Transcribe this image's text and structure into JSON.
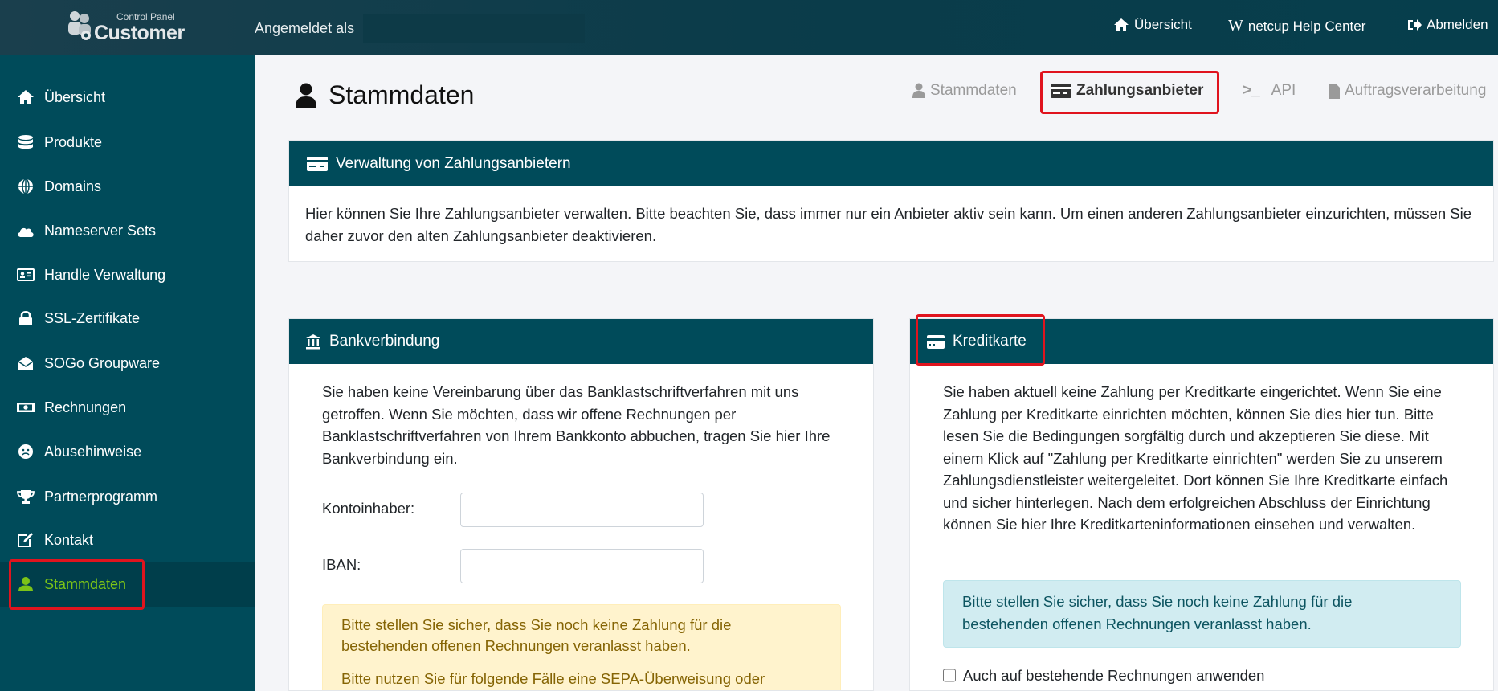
{
  "header": {
    "logo": {
      "top": "Control Panel",
      "main": "Customer"
    },
    "logged_in_label": "Angemeldet als",
    "links": [
      {
        "label": "Übersicht",
        "icon": "home-icon"
      },
      {
        "label": "netcup Help Center",
        "icon": "wiki-icon",
        "glyph": "W"
      },
      {
        "label": "Abmelden",
        "icon": "logout-icon"
      }
    ]
  },
  "sidebar": {
    "items": [
      {
        "label": "Übersicht",
        "icon": "home-icon"
      },
      {
        "label": "Produkte",
        "icon": "database-icon"
      },
      {
        "label": "Domains",
        "icon": "globe-icon"
      },
      {
        "label": "Nameserver Sets",
        "icon": "cloud-icon"
      },
      {
        "label": "Handle Verwaltung",
        "icon": "id-card-icon"
      },
      {
        "label": "SSL-Zertifikate",
        "icon": "lock-icon"
      },
      {
        "label": "SOGo Groupware",
        "icon": "envelope-open-icon"
      },
      {
        "label": "Rechnungen",
        "icon": "money-icon"
      },
      {
        "label": "Abusehinweise",
        "icon": "frown-icon"
      },
      {
        "label": "Partnerprogramm",
        "icon": "trophy-icon"
      },
      {
        "label": "Kontakt",
        "icon": "edit-icon"
      },
      {
        "label": "Stammdaten",
        "icon": "user-icon",
        "active": true
      }
    ],
    "active_color": "#7cc318"
  },
  "page": {
    "title": "Stammdaten",
    "tabs": [
      {
        "label": "Stammdaten",
        "icon": "user-icon"
      },
      {
        "label": "Zahlungsanbieter",
        "icon": "credit-card-icon",
        "active": true
      },
      {
        "label": "API",
        "icon": "terminal-icon"
      },
      {
        "label": "Auftragsverarbeitung",
        "icon": "file-icon"
      }
    ]
  },
  "overview_panel": {
    "title": "Verwaltung von Zahlungsanbietern",
    "text": "Hier können Sie Ihre Zahlungsanbieter verwalten. Bitte beachten Sie, dass immer nur ein Anbieter aktiv sein kann. Um einen anderen Zahlungsanbieter einzurichten, müssen Sie daher zuvor den alten Zahlungsanbieter deaktivieren."
  },
  "bank_panel": {
    "title": "Bankverbindung",
    "text": "Sie haben keine Vereinbarung über das Banklastschriftverfahren mit uns getroffen. Wenn Sie möchten, dass wir offene Rechnungen per Banklastschriftverfahren von Ihrem Bankkonto abbuchen, tragen Sie hier Ihre Bankverbindung ein.",
    "fields": [
      {
        "label": "Kontoinhaber:",
        "value": ""
      },
      {
        "label": "IBAN:",
        "value": ""
      }
    ],
    "alert": "Bitte stellen Sie sicher, dass Sie noch keine Zahlung für die bestehenden offenen Rechnungen veranlasst haben.",
    "alert2": "Bitte nutzen Sie für folgende Fälle eine SEPA-Überweisung oder"
  },
  "card_panel": {
    "title": "Kreditkarte",
    "text": "Sie haben aktuell keine Zahlung per Kreditkarte eingerichtet. Wenn Sie eine Zahlung per Kreditkarte einrichten möchten, können Sie dies hier tun. Bitte lesen Sie die Bedingungen sorgfältig durch und akzeptieren Sie diese. Mit einem Klick auf \"Zahlung per Kreditkarte einrichten\" werden Sie zu unserem Zahlungsdienstleister weitergeleitet. Dort können Sie Ihre Kreditkarte einfach und sicher hinterlegen. Nach dem erfolgreichen Abschluss der Einrichtung können Sie hier Ihre Kreditkarteninformationen einsehen und verwalten.",
    "alert": "Bitte stellen Sie sicher, dass Sie noch keine Zahlung für die bestehenden offenen Rechnungen veranlasst haben.",
    "checkbox": {
      "label": "Auch auf bestehende Rechnungen anwenden",
      "checked": false
    }
  },
  "colors": {
    "brand": "#004b5a",
    "highlight": "#e0141e",
    "warning_bg": "#fff3cd",
    "info_bg": "#d1ecf1"
  }
}
